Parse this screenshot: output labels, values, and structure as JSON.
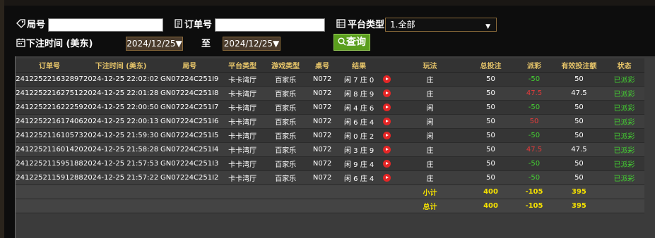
{
  "filters": {
    "round_label": "局号",
    "round_value": "",
    "order_label": "订单号",
    "order_value": "",
    "platform_label": "平台类型",
    "platform_selected": "1.全部",
    "time_label": "下注时间 (美东)",
    "date_from": "2024/12/25",
    "to_label": "至",
    "date_to": "2024/12/25",
    "query_label": "查询"
  },
  "table": {
    "headers": [
      "订单号",
      "下注时间 (美东)",
      "局号",
      "平台类型",
      "游戏类型",
      "桌号",
      "结果",
      "",
      "玩法",
      "总投注",
      "派彩",
      "有效投注额",
      "状态"
    ],
    "rows": [
      [
        "241225221632897",
        "2024-12-25 22:02:02",
        "GN07224C251I9",
        "卡卡湾厅",
        "百家乐",
        "N072",
        "闲 7 庄 0",
        "",
        "庄",
        "50",
        "-50",
        "50",
        "已派彩"
      ],
      [
        "241225221627512",
        "2024-12-25 22:01:28",
        "GN07224C251I8",
        "卡卡湾厅",
        "百家乐",
        "N072",
        "闲 8 庄 9",
        "",
        "庄",
        "50",
        "47.5",
        "47.5",
        "已派彩"
      ],
      [
        "241225221622259",
        "2024-12-25 22:00:50",
        "GN07224C251I7",
        "卡卡湾厅",
        "百家乐",
        "N072",
        "闲 4 庄 6",
        "",
        "闲",
        "50",
        "-50",
        "50",
        "已派彩"
      ],
      [
        "241225221617406",
        "2024-12-25 22:00:13",
        "GN07224C251I6",
        "卡卡湾厅",
        "百家乐",
        "N072",
        "闲 6 庄 4",
        "",
        "闲",
        "50",
        "50",
        "50",
        "已派彩"
      ],
      [
        "241225211610573",
        "2024-12-25 21:59:30",
        "GN07224C251I5",
        "卡卡湾厅",
        "百家乐",
        "N072",
        "闲 0 庄 2",
        "",
        "闲",
        "50",
        "-50",
        "50",
        "已派彩"
      ],
      [
        "241225211601420",
        "2024-12-25 21:58:28",
        "GN07224C251I4",
        "卡卡湾厅",
        "百家乐",
        "N072",
        "闲 3 庄 9",
        "",
        "庄",
        "50",
        "47.5",
        "47.5",
        "已派彩"
      ],
      [
        "241225211595188",
        "2024-12-25 21:57:53",
        "GN07224C251I3",
        "卡卡湾厅",
        "百家乐",
        "N072",
        "闲 9 庄 4",
        "",
        "庄",
        "50",
        "-50",
        "50",
        "已派彩"
      ],
      [
        "241225211591288",
        "2024-12-25 21:57:22",
        "GN07224C251I2",
        "卡卡湾厅",
        "百家乐",
        "N072",
        "闲 6 庄 4",
        "",
        "庄",
        "50",
        "-50",
        "50",
        "已派彩"
      ]
    ],
    "payout_colors": [
      "green",
      "red",
      "green",
      "red",
      "green",
      "red",
      "green",
      "green"
    ],
    "subtotal": {
      "label": "小计",
      "total_bet": "400",
      "payout": "-105",
      "valid_bet": "395"
    },
    "grand_total": {
      "label": "总计",
      "total_bet": "400",
      "payout": "-105",
      "valid_bet": "395"
    }
  },
  "colors": {
    "accent_gold": "#e8c66a",
    "status_green": "#44d232",
    "payout_red": "#e63a3a",
    "summary_yellow": "#f5e100",
    "query_button": "#5a9e1d"
  },
  "icons": {
    "round": "tag-icon",
    "order": "receipt-icon",
    "platform": "list-icon",
    "time": "calendar-icon",
    "query": "search-icon",
    "video": "play-video-icon"
  }
}
